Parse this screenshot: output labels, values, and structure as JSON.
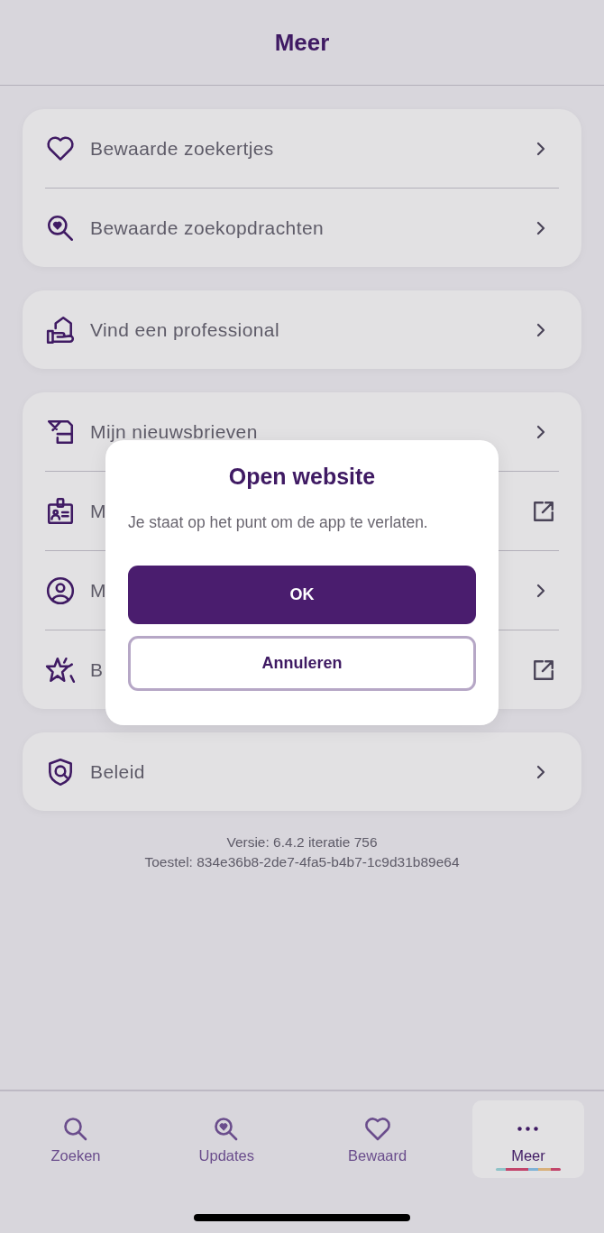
{
  "header": {
    "title": "Meer"
  },
  "groups": [
    {
      "items": [
        {
          "label": "Bewaarde zoekertjes",
          "kind": "link"
        },
        {
          "label": "Bewaarde zoekopdrachten",
          "kind": "link"
        }
      ]
    },
    {
      "items": [
        {
          "label": "Vind een professional",
          "kind": "link"
        }
      ]
    },
    {
      "items": [
        {
          "label": "Mijn nieuwsbrieven",
          "kind": "link"
        },
        {
          "label": "M",
          "kind": "external"
        },
        {
          "label": "M",
          "kind": "link"
        },
        {
          "label": "B",
          "kind": "external"
        }
      ]
    },
    {
      "items": [
        {
          "label": "Beleid",
          "kind": "link"
        }
      ]
    }
  ],
  "version": "Versie: 6.4.2 iteratie 756",
  "device": "Toestel: 834e36b8-2de7-4fa5-b4b7-1c9d31b89e64",
  "dialog": {
    "title": "Open website",
    "message": "Je staat op het punt om de app te verlaten.",
    "buttons": [
      {
        "label": "OK",
        "kind": "primary"
      },
      {
        "label": "Annuleren",
        "kind": "secondary"
      }
    ]
  },
  "tabs": [
    {
      "label": "Zoeken",
      "selected": false
    },
    {
      "label": "Updates",
      "selected": false
    },
    {
      "label": "Bewaard",
      "selected": false
    },
    {
      "label": "Meer",
      "selected": true
    }
  ]
}
